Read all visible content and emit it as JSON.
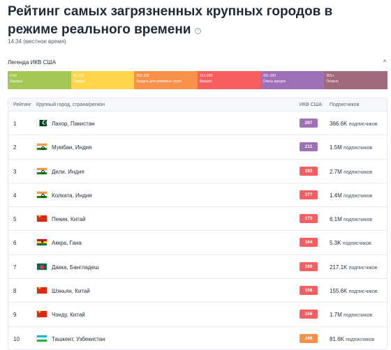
{
  "page": {
    "title": "Рейтинг самых загрязненных крупных городов в режиме реального времени",
    "info_icon": "i",
    "timestamp": "14:34 (местное время)"
  },
  "legend": {
    "title": "Легенда ИКВ США",
    "caret": "^",
    "segments": [
      {
        "range": "0-50",
        "label": "Хорошо",
        "color": "#a3c853"
      },
      {
        "range": "51-100",
        "label": "Средне",
        "color": "#fdd64b"
      },
      {
        "range": "101-150",
        "label": "Вредно для уязвимых групп",
        "color": "#f99049"
      },
      {
        "range": "151-200",
        "label": "Вредно",
        "color": "#f65e5f"
      },
      {
        "range": "201-300",
        "label": "Очень вредно",
        "color": "#a070b6"
      },
      {
        "range": "301+",
        "label": "Опасно",
        "color": "#a06a7b"
      }
    ]
  },
  "table": {
    "headers": {
      "rank": "Рейтинг",
      "city": "Крупный город, страна/регион",
      "aqi": "ИКВ США",
      "followers": "Подписчиков"
    },
    "rows": [
      {
        "rank": "1",
        "flag": "flag-pk-icon",
        "city": "Лахор, Пакистан",
        "aqi": "297",
        "aqi_color": "#a070b6",
        "count": "366.6K",
        "suffix": "подписчиков"
      },
      {
        "rank": "2",
        "flag": "flag-in-icon",
        "city": "Мумбаи, Индия",
        "aqi": "211",
        "aqi_color": "#a070b6",
        "count": "1.5M",
        "suffix": "подписчиков"
      },
      {
        "rank": "3",
        "flag": "flag-in-icon",
        "city": "Дели, Индия",
        "aqi": "193",
        "aqi_color": "#f65e5f",
        "count": "2.7M",
        "suffix": "подписчиков"
      },
      {
        "rank": "4",
        "flag": "flag-in-icon",
        "city": "Колката, Индия",
        "aqi": "177",
        "aqi_color": "#f65e5f",
        "count": "1.4M",
        "suffix": "подписчиков"
      },
      {
        "rank": "5",
        "flag": "flag-cn-icon",
        "city": "Пекин, Китай",
        "aqi": "173",
        "aqi_color": "#f65e5f",
        "count": "6.1M",
        "suffix": "подписчиков"
      },
      {
        "rank": "6",
        "flag": "flag-gh-icon",
        "city": "Аккра, Гана",
        "aqi": "164",
        "aqi_color": "#f65e5f",
        "count": "5.3K",
        "suffix": "подписчиков"
      },
      {
        "rank": "7",
        "flag": "flag-bd-icon",
        "city": "Дакка, Бангладеш",
        "aqi": "160",
        "aqi_color": "#f65e5f",
        "count": "217.1K",
        "suffix": "подписчиков"
      },
      {
        "rank": "8",
        "flag": "flag-cn-icon",
        "city": "Шэньян, Китай",
        "aqi": "156",
        "aqi_color": "#f65e5f",
        "count": "155.6K",
        "suffix": "подписчиков"
      },
      {
        "rank": "9",
        "flag": "flag-cn-icon",
        "city": "Чэнду, Китай",
        "aqi": "156",
        "aqi_color": "#f65e5f",
        "count": "1.7M",
        "suffix": "подписчиков"
      },
      {
        "rank": "10",
        "flag": "flag-uz-icon",
        "city": "Ташкент, Узбекистан",
        "aqi": "146",
        "aqi_color": "#f99049",
        "count": "81.6K",
        "suffix": "подписчиков"
      }
    ]
  }
}
